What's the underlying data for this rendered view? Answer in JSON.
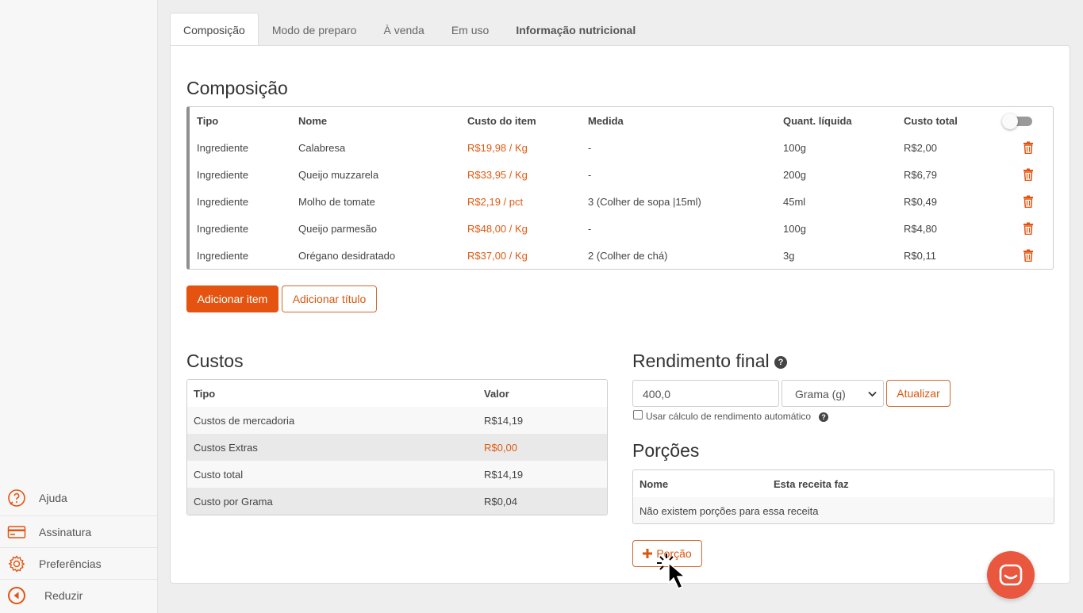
{
  "sidebar": {
    "items": [
      {
        "label": "Ajuda",
        "icon": "help-circle-icon"
      },
      {
        "label": "Assinatura",
        "icon": "credit-card-icon"
      },
      {
        "label": "Preferências",
        "icon": "gear-icon"
      },
      {
        "label": "Reduzir",
        "icon": "collapse-left-icon"
      }
    ]
  },
  "tabs": [
    {
      "label": "Composição",
      "active": true
    },
    {
      "label": "Modo de preparo"
    },
    {
      "label": "À venda"
    },
    {
      "label": "Em uso"
    },
    {
      "label": "Informação nutricional"
    }
  ],
  "composition": {
    "title": "Composição",
    "headers": [
      "Tipo",
      "Nome",
      "Custo do item",
      "Medida",
      "Quant. líquida",
      "Custo total"
    ],
    "rows": [
      [
        "Ingrediente",
        "Calabresa",
        "R$19,98 / Kg",
        "-",
        "100g",
        "R$2,00"
      ],
      [
        "Ingrediente",
        "Queijo muzzarela",
        "R$33,95 / Kg",
        "-",
        "200g",
        "R$6,79"
      ],
      [
        "Ingrediente",
        "Molho de tomate",
        "R$2,19 / pct",
        "3 (Colher de sopa |15ml)",
        "45ml",
        "R$0,49"
      ],
      [
        "Ingrediente",
        "Queijo parmesão",
        "R$48,00 / Kg",
        "-",
        "100g",
        "R$4,80"
      ],
      [
        "Ingrediente",
        "Orégano desidratado",
        "R$37,00 / Kg",
        "2 (Colher de chá)",
        "3g",
        "R$0,11"
      ]
    ],
    "add_item": "Adicionar item",
    "add_title": "Adicionar título"
  },
  "costs": {
    "title": "Custos",
    "headers": [
      "Tipo",
      "Valor"
    ],
    "rows": [
      [
        "Custos de mercadoria",
        "R$14,19"
      ],
      [
        "Custos Extras",
        "R$0,00"
      ],
      [
        "Custo total",
        "R$14,19"
      ],
      [
        "Custo por Grama",
        "R$0,04"
      ]
    ]
  },
  "yield": {
    "title": "Rendimento final",
    "value": "400,0",
    "unit": "Grama (g)",
    "update": "Atualizar",
    "auto_label": "Usar cálculo de rendimento automático"
  },
  "portions": {
    "title": "Porções",
    "headers": [
      "Nome",
      "Esta receita faz"
    ],
    "empty": "Não existem porções para essa receita",
    "add": "Porção"
  },
  "colors": {
    "accent": "#e4530f",
    "chat": "#e9573f"
  }
}
